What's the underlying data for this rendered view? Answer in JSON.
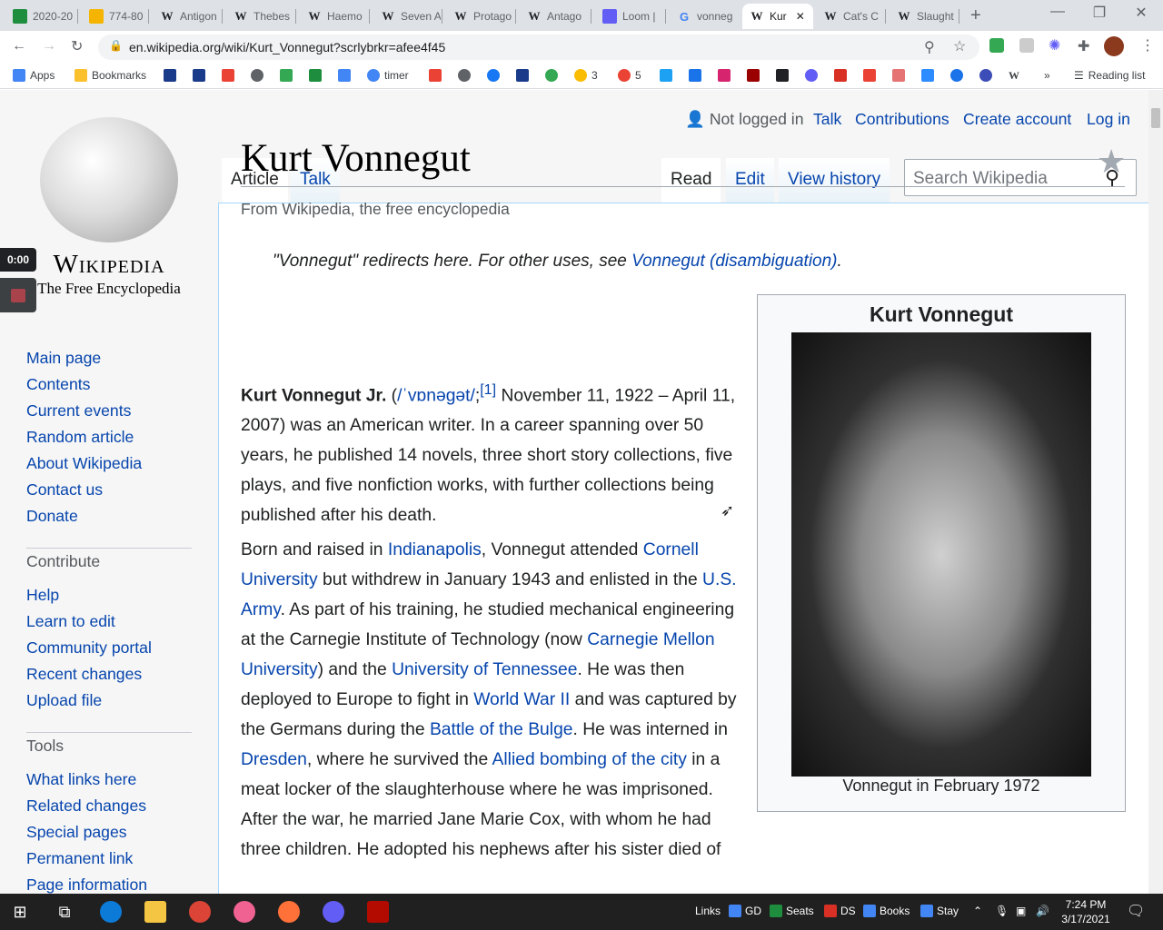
{
  "browser": {
    "tabs": [
      {
        "label": "2020-20",
        "icon": "sheets-icon",
        "color": "#1e8e3e"
      },
      {
        "label": "774-80",
        "icon": "slides-icon",
        "color": "#f4b400"
      },
      {
        "label": "Antigon",
        "icon": "wikipedia-icon"
      },
      {
        "label": "Thebes",
        "icon": "wikipedia-icon"
      },
      {
        "label": "Haemo",
        "icon": "wikipedia-icon"
      },
      {
        "label": "Seven A",
        "icon": "wikipedia-icon"
      },
      {
        "label": "Protago",
        "icon": "wikipedia-icon"
      },
      {
        "label": "Antago",
        "icon": "wikipedia-icon"
      },
      {
        "label": "Loom |",
        "icon": "loom-icon",
        "color": "#625df5"
      },
      {
        "label": "vonneg",
        "icon": "google-icon"
      },
      {
        "label": "Kur",
        "icon": "wikipedia-icon"
      },
      {
        "label": "Cat's C",
        "icon": "wikipedia-icon"
      },
      {
        "label": "Slaught",
        "icon": "wikipedia-icon"
      }
    ],
    "url": "en.wikipedia.org/wiki/Kurt_Vonnegut?scrlybrkr=afee4f45",
    "bookmarks": [
      {
        "label": "Apps",
        "color": "#4285f4"
      },
      {
        "label": "Bookmarks",
        "color": "#fbc02d"
      },
      {
        "label": "timer",
        "color": "#4285f4"
      },
      {
        "label": "3",
        "color": "#34a853"
      },
      {
        "label": "5",
        "color": "#ea4335"
      }
    ],
    "reading_list": "Reading list",
    "more": "»"
  },
  "wiki": {
    "wordmark": "Wikipedia",
    "tagline": "The Free Encyclopedia",
    "nav": [
      "Main page",
      "Contents",
      "Current events",
      "Random article",
      "About Wikipedia",
      "Contact us",
      "Donate"
    ],
    "contribute_heading": "Contribute",
    "contribute": [
      "Help",
      "Learn to edit",
      "Community portal",
      "Recent changes",
      "Upload file"
    ],
    "tools_heading": "Tools",
    "tools": [
      "What links here",
      "Related changes",
      "Special pages",
      "Permanent link",
      "Page information"
    ],
    "personal": {
      "not_logged": "Not logged in",
      "talk": "Talk",
      "contributions": "Contributions",
      "create": "Create account",
      "login": "Log in"
    },
    "tabs": {
      "article": "Article",
      "talk": "Talk",
      "read": "Read",
      "edit": "Edit",
      "history": "View history"
    },
    "search_placeholder": "Search Wikipedia",
    "title": "Kurt Vonnegut",
    "from": "From Wikipedia, the free encyclopedia",
    "hatnote": {
      "prefix": "\"Vonnegut\" redirects here. For other uses, see ",
      "link": "Vonnegut (disambiguation)",
      "suffix": "."
    },
    "p1": {
      "name": "Kurt Vonnegut Jr.",
      "ipa_open": " (",
      "ipa": "/ˈvɒnəɡət/",
      "ipa_close": ";",
      "ref": "[1]",
      "rest": " November 11, 1922 – April 11, 2007) was an American writer. In a career spanning over 50 years, he published 14 novels, three short story collections, five plays, and five nonfiction works, with further collections being published after his death."
    },
    "p2": [
      {
        "t": "Born and raised in "
      },
      {
        "l": "Indianapolis"
      },
      {
        "t": ", Vonnegut attended "
      },
      {
        "l": "Cornell University"
      },
      {
        "t": " but withdrew in January 1943 and enlisted in the "
      },
      {
        "l": "U.S. Army"
      },
      {
        "t": ". As part of his training, he studied mechanical engineering at the Carnegie Institute of Technology (now "
      },
      {
        "l": "Carnegie Mellon University"
      },
      {
        "t": ") and the "
      },
      {
        "l": "University of Tennessee"
      },
      {
        "t": ". He was then deployed to Europe to fight in "
      },
      {
        "l": "World War II"
      },
      {
        "t": " and was captured by the Germans during the "
      },
      {
        "l": "Battle of the Bulge"
      },
      {
        "t": ". He was interned in "
      },
      {
        "l": "Dresden"
      },
      {
        "t": ", where he survived the "
      },
      {
        "l": "Allied bombing of the city"
      },
      {
        "t": " in a meat locker of the slaughterhouse where he was imprisoned. After the war, he married Jane Marie Cox, with whom he had three children. He adopted his nephews after his sister died of"
      }
    ],
    "infobox": {
      "title": "Kurt Vonnegut",
      "caption": "Vonnegut in February 1972"
    }
  },
  "recorder": {
    "time": "0:00"
  },
  "taskbar": {
    "links_label": "Links",
    "links": [
      {
        "label": "GD",
        "color": "#4285f4"
      },
      {
        "label": "Seats",
        "color": "#1e8e3e"
      },
      {
        "label": "DS",
        "color": "#d93025"
      },
      {
        "label": "Books",
        "color": "#4285f4"
      },
      {
        "label": "Stay",
        "color": "#4285f4"
      }
    ],
    "time": "7:24 PM",
    "date": "3/17/2021"
  }
}
